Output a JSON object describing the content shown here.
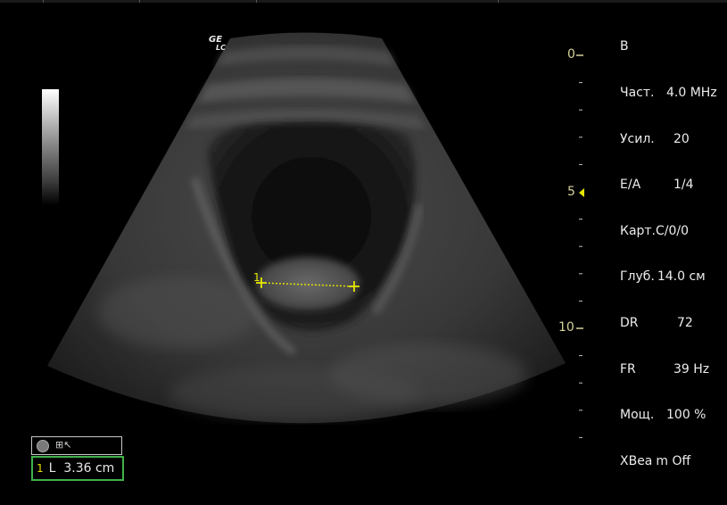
{
  "brand": {
    "logo_top": "GE",
    "logo_bottom": "LC"
  },
  "mode": "B",
  "parameters": [
    {
      "key": "Част.",
      "value": "4.0 MHz"
    },
    {
      "key": "Усил.",
      "value": "20"
    },
    {
      "key": "E/A",
      "value": "1/4"
    },
    {
      "key": "Карт.",
      "value": "C/0/0"
    },
    {
      "key": "Глуб.",
      "value": "14.0 см"
    },
    {
      "key": "DR",
      "value": "72"
    },
    {
      "key": "FR",
      "value": "39 Hz"
    },
    {
      "key": "Мощ.",
      "value": "100 %"
    },
    {
      "key": "XBea",
      "value": "m Off"
    }
  ],
  "depth_scale": {
    "label_0": "0",
    "label_5": "5",
    "label_10": "10",
    "unit": "cm",
    "max": 14
  },
  "caliper": {
    "marker": "1"
  },
  "measurement": {
    "index": "1",
    "type": "L",
    "value": "3.36 cm",
    "icon": "caliper-icon"
  },
  "colors": {
    "caliper": "#e6e600",
    "depth_labels": "#d6d29a",
    "measurement_border": "#3fb24a"
  }
}
